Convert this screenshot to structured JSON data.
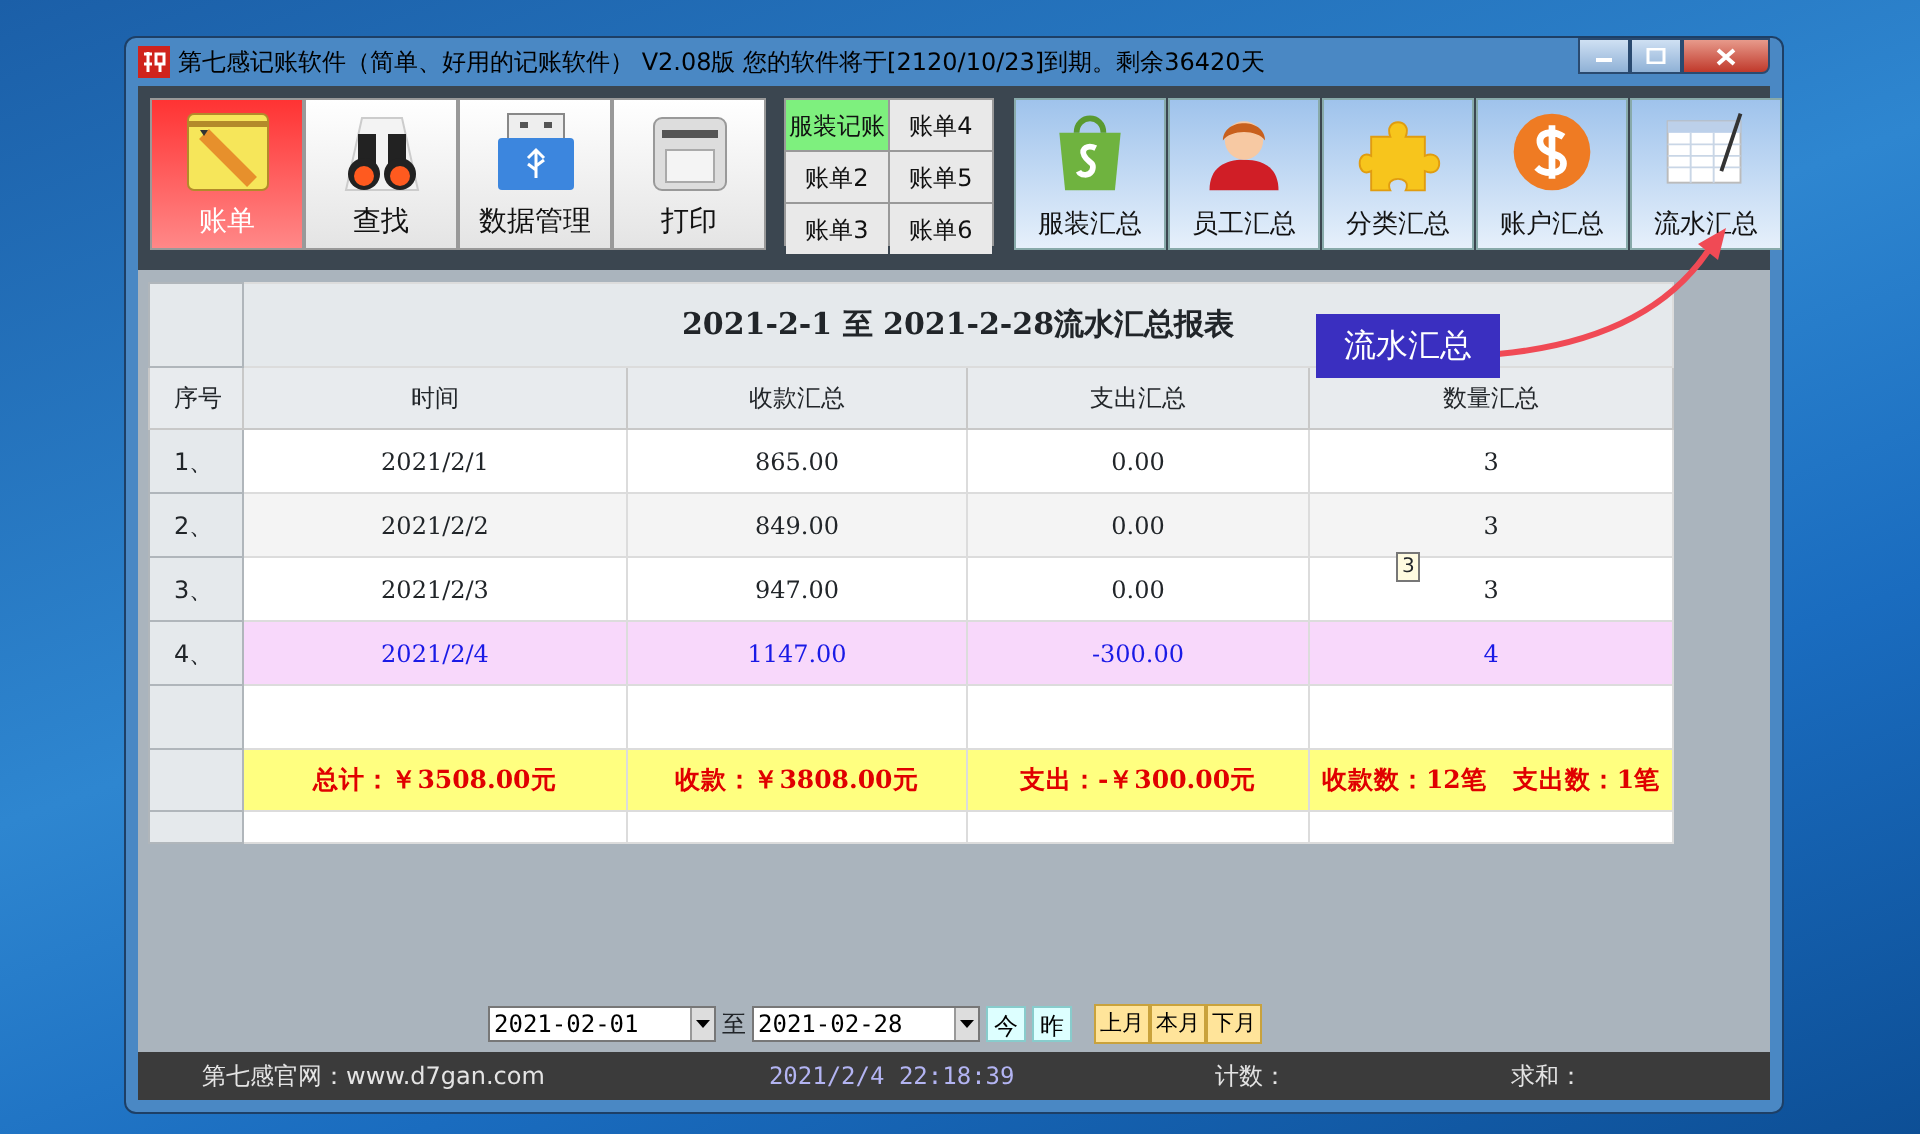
{
  "window": {
    "title": "第七感记账软件（简单、好用的记账软件） V2.08版 您的软件将于[2120/10/23]到期。剩余36420天"
  },
  "toolbar": {
    "main_buttons": [
      {
        "label": "账单",
        "selected": true
      },
      {
        "label": "查找",
        "selected": false
      },
      {
        "label": "数据管理",
        "selected": false
      },
      {
        "label": "打印",
        "selected": false
      }
    ],
    "ledger_buttons": [
      {
        "label": "服装记账",
        "selected": true
      },
      {
        "label": "账单4",
        "selected": false
      },
      {
        "label": "账单2",
        "selected": false
      },
      {
        "label": "账单5",
        "selected": false
      },
      {
        "label": "账单3",
        "selected": false
      },
      {
        "label": "账单6",
        "selected": false
      }
    ],
    "summary_buttons": [
      {
        "label": "服装汇总"
      },
      {
        "label": "员工汇总"
      },
      {
        "label": "分类汇总"
      },
      {
        "label": "账户汇总"
      },
      {
        "label": "流水汇总"
      }
    ]
  },
  "report": {
    "title": "2021-2-1 至 2021-2-28流水汇总报表",
    "columns": [
      "序号",
      "时间",
      "收款汇总",
      "支出汇总",
      "数量汇总"
    ],
    "rows": [
      {
        "cells": [
          "1、",
          "2021/2/1",
          "865.00",
          "0.00",
          "3"
        ],
        "highlighted": false
      },
      {
        "cells": [
          "2、",
          "2021/2/2",
          "849.00",
          "0.00",
          "3"
        ],
        "highlighted": false
      },
      {
        "cells": [
          "3、",
          "2021/2/3",
          "947.00",
          "0.00",
          "3"
        ],
        "highlighted": false
      },
      {
        "cells": [
          "4、",
          "2021/2/4",
          "1147.00",
          "-300.00",
          "4"
        ],
        "highlighted": true
      }
    ],
    "totals": [
      "总计：￥3508.00元",
      "收款：￥3808.00元",
      "支出：-￥300.00元",
      "收款数：12笔　支出数：1笔"
    ],
    "tooltip": "3"
  },
  "callout": {
    "label": "流水汇总"
  },
  "date_bar": {
    "date_from": "2021-02-01",
    "to_label": "至",
    "date_to": "2021-02-28",
    "quick_buttons": [
      "今",
      "昨"
    ],
    "month_buttons": [
      "上月",
      "本月",
      "下月"
    ]
  },
  "status_bar": {
    "site": "第七感官网：www.d7gan.com",
    "datetime": "2021/2/4 22:18:39",
    "count_label": "计数：",
    "sum_label": "求和："
  }
}
